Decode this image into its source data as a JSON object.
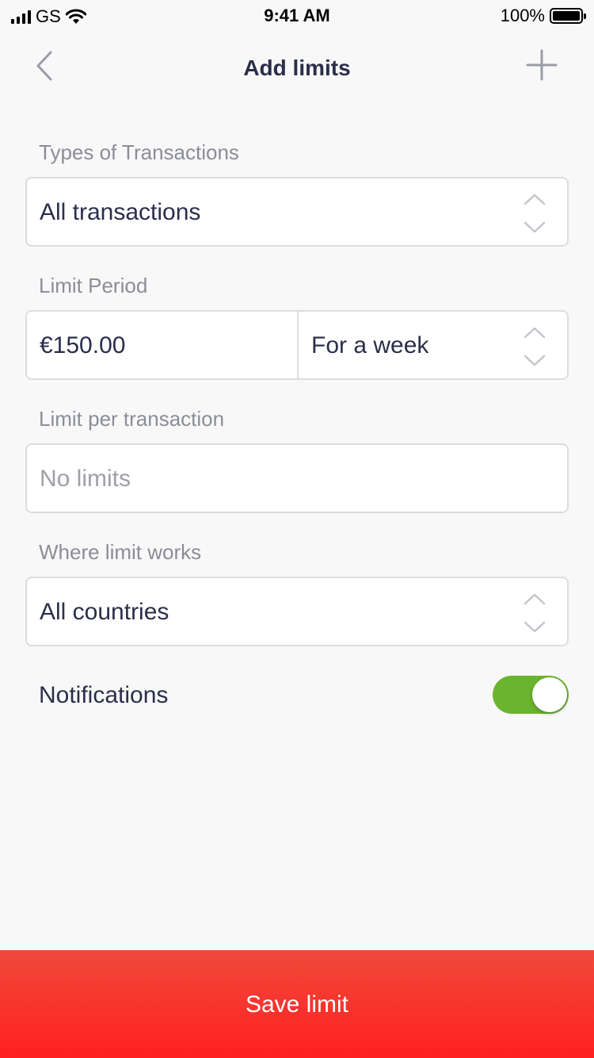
{
  "status_bar": {
    "carrier": "GS",
    "time": "9:41 AM",
    "battery": "100%"
  },
  "nav": {
    "title": "Add limits",
    "back_icon": "chevron-left-icon",
    "add_icon": "plus-icon"
  },
  "form": {
    "types_label": "Types of Transactions",
    "types_value": "All transactions",
    "period_label": "Limit Period",
    "period_amount": "€150.00",
    "period_value": "For a week",
    "per_tx_label": "Limit per transaction",
    "per_tx_placeholder": "No limits",
    "where_label": "Where limit works",
    "where_value": "All countries",
    "notifications_label": "Notifications",
    "notifications_on": true
  },
  "save_button": {
    "label": "Save limit"
  },
  "colors": {
    "accent": "#ff2a24",
    "toggle_on": "#6ab42f",
    "text": "#2b2e4a",
    "muted": "#8b8d98"
  }
}
